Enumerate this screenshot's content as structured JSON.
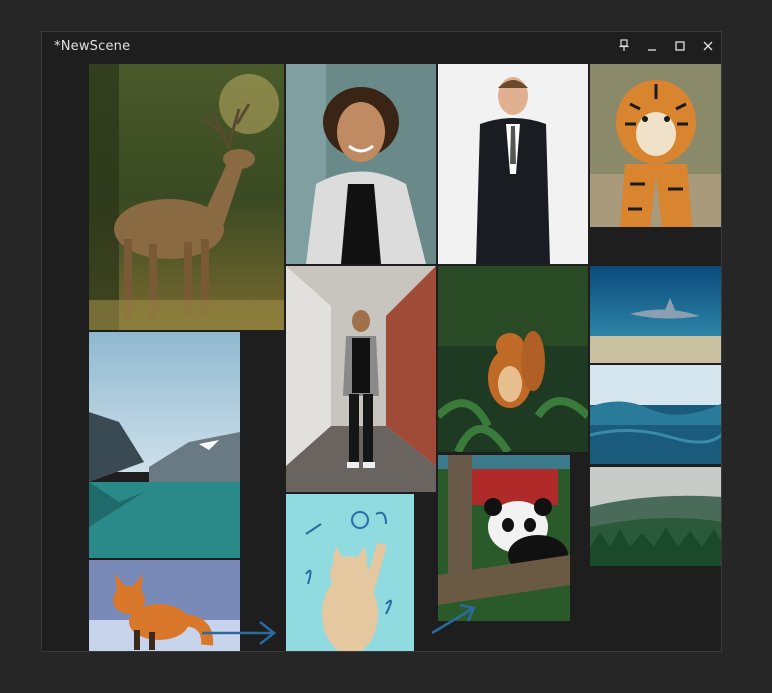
{
  "window": {
    "title": "*NewScene"
  },
  "controls": [
    "pin-icon",
    "minimize-icon",
    "maximize-icon",
    "close-icon"
  ],
  "images": [
    "deer",
    "woman-portrait",
    "man-in-suit",
    "tiger",
    "lake-mountains",
    "man-in-alley",
    "squirrel",
    "shark",
    "ocean-waves",
    "cat",
    "panda",
    "misty-forest",
    "fox"
  ]
}
